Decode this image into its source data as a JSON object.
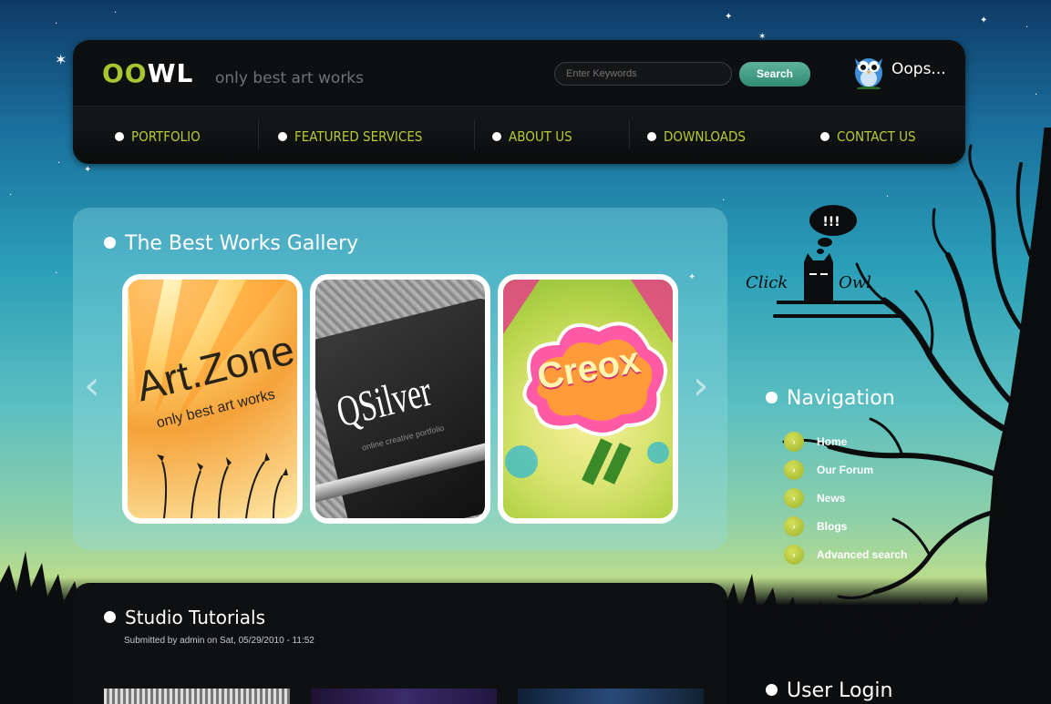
{
  "header": {
    "logo_oo": "OO",
    "logo_wl": "WL",
    "tagline": "only best art works",
    "search": {
      "placeholder": "Enter Keywords",
      "button_label": "Search"
    },
    "user_label": "Oops..."
  },
  "nav": {
    "items": [
      {
        "label": "PORTFOLIO"
      },
      {
        "label": "FEATURED SERVICES"
      },
      {
        "label": "ABOUT US"
      },
      {
        "label": "DOWNLOADS"
      },
      {
        "label": "CONTACT US"
      }
    ]
  },
  "gallery": {
    "title": "The Best Works Gallery",
    "items": [
      {
        "title": "Art.Zone",
        "subtitle": "only best art works"
      },
      {
        "title": "QSilver",
        "subtitle": "online creative portfolio"
      },
      {
        "title": "Creox"
      }
    ],
    "prev_icon": "‹",
    "next_icon": "›"
  },
  "sidebar": {
    "mascot": {
      "bubble": "!!!",
      "left_text": "Click",
      "right_text": "Owl"
    },
    "navigation_title": "Navigation",
    "links": [
      {
        "label": "Home"
      },
      {
        "label": "Our Forum"
      },
      {
        "label": "News"
      },
      {
        "label": "Blogs"
      },
      {
        "label": "Advanced search"
      }
    ],
    "login_title": "User Login"
  },
  "tutorials": {
    "title": "Studio Tutorials",
    "meta": "Submitted by admin on Sat, 05/29/2010 - 11:52"
  },
  "colors": {
    "accent_green": "#b4cc36",
    "button_teal": "#3a9a80",
    "panel_dark": "#0d0f10"
  },
  "icons": [
    "search-icon",
    "owl-avatar-icon",
    "chevron-left-icon",
    "chevron-right-icon",
    "arrow-bullet-icon",
    "dot-bullet-icon"
  ]
}
